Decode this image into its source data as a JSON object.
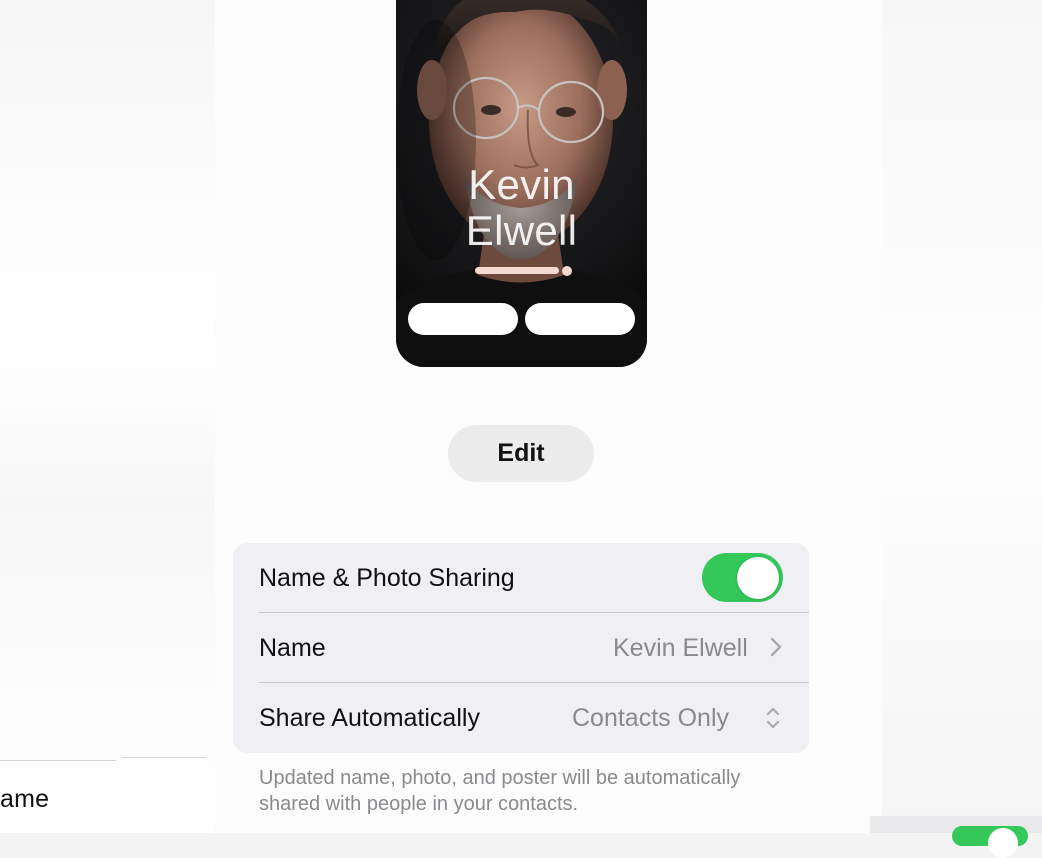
{
  "poster": {
    "first_name": "Kevin",
    "last_name": "Elwell"
  },
  "edit_button": {
    "label": "Edit"
  },
  "settings": {
    "sharing_row": {
      "label": "Name & Photo Sharing",
      "toggle_on": true
    },
    "name_row": {
      "label": "Name",
      "value": "Kevin Elwell"
    },
    "share_row": {
      "label": "Share Automatically",
      "value": "Contacts Only"
    }
  },
  "footer_note": "Updated name, photo, and poster will be automatically shared with people in your contacts.",
  "background": {
    "left_partial_label": "ame"
  },
  "colors": {
    "toggle_on": "#34c759",
    "group_bg": "#f0f0f4",
    "secondary_text": "#8a8a8e"
  },
  "icons": [
    "chevron-right-icon",
    "up-down-chevron-icon"
  ]
}
